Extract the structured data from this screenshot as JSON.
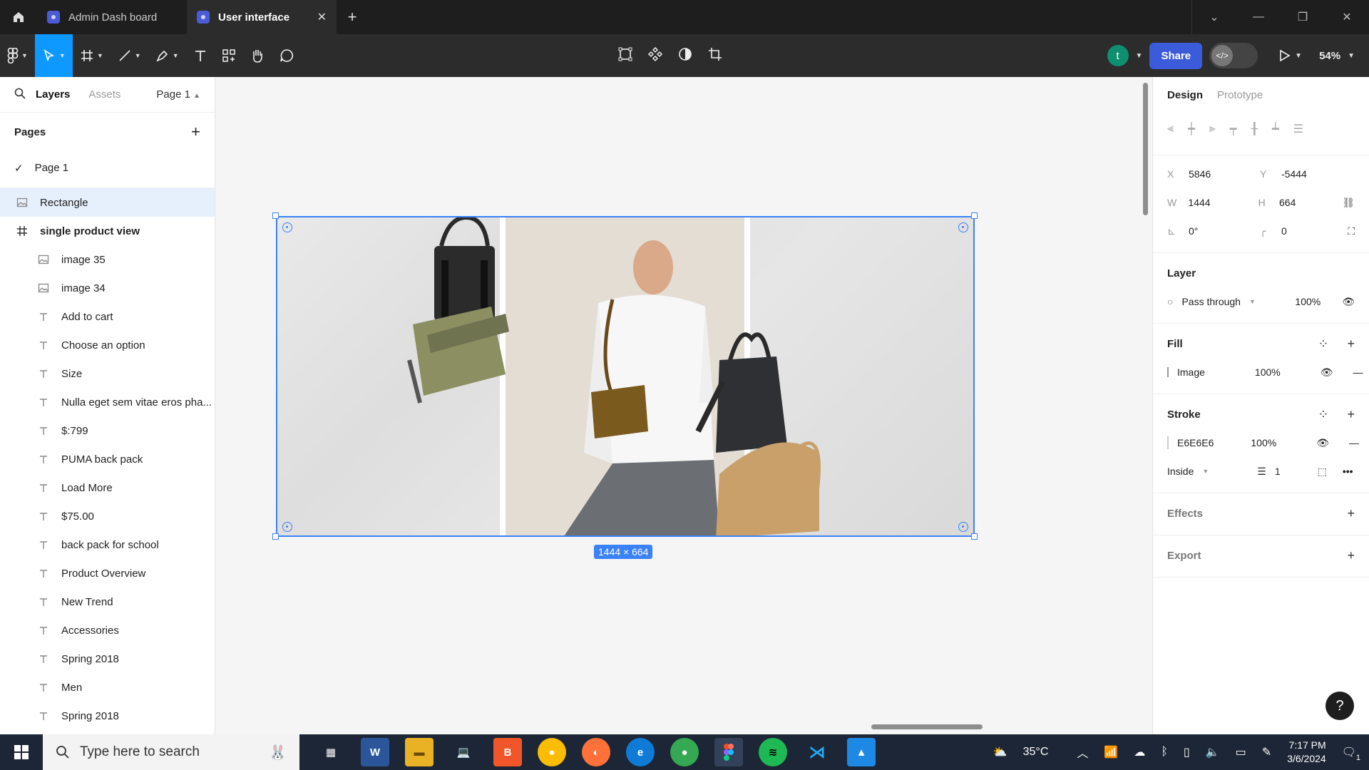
{
  "tabs": [
    {
      "label": "Admin Dash board",
      "active": false
    },
    {
      "label": "User interface",
      "active": true
    }
  ],
  "window_controls": {
    "dropdown": "⌄",
    "minimize": "—",
    "restore": "❐",
    "close": "✕"
  },
  "toolbar": {
    "avatar_initial": "t",
    "share_label": "Share",
    "zoom": "54%"
  },
  "left_panel": {
    "tabs": [
      "Layers",
      "Assets"
    ],
    "page_selector": "Page 1",
    "pages_heading": "Pages",
    "pages": [
      "Page 1"
    ],
    "layers": [
      {
        "label": "Rectangle",
        "type": "image",
        "selected": true
      },
      {
        "label": "single product view",
        "type": "frame"
      },
      {
        "label": "image 35",
        "type": "image"
      },
      {
        "label": "image 34",
        "type": "image"
      },
      {
        "label": "Add to cart",
        "type": "text"
      },
      {
        "label": "Choose an option",
        "type": "text"
      },
      {
        "label": "Size",
        "type": "text"
      },
      {
        "label": "Nulla eget sem vitae eros pha...",
        "type": "text"
      },
      {
        "label": "$:799",
        "type": "text"
      },
      {
        "label": "PUMA back pack",
        "type": "text"
      },
      {
        "label": "Load More",
        "type": "text"
      },
      {
        "label": "$75.00",
        "type": "text"
      },
      {
        "label": "back pack for school",
        "type": "text"
      },
      {
        "label": "Product Overview",
        "type": "text"
      },
      {
        "label": "New Trend",
        "type": "text"
      },
      {
        "label": "Accessories",
        "type": "text"
      },
      {
        "label": "Spring 2018",
        "type": "text"
      },
      {
        "label": "Men",
        "type": "text"
      },
      {
        "label": "Spring 2018",
        "type": "text"
      }
    ]
  },
  "canvas": {
    "dimension_badge": "1444 × 664"
  },
  "right_panel": {
    "tabs": [
      "Design",
      "Prototype"
    ],
    "props": {
      "x_label": "X",
      "x": "5846",
      "y_label": "Y",
      "y": "-5444",
      "w_label": "W",
      "w": "1444",
      "h_label": "H",
      "h": "664",
      "rotation": "0°",
      "radius": "0"
    },
    "layer": {
      "heading": "Layer",
      "blend": "Pass through",
      "opacity": "100%"
    },
    "fill": {
      "heading": "Fill",
      "type": "Image",
      "opacity": "100%"
    },
    "stroke": {
      "heading": "Stroke",
      "color": "E6E6E6",
      "opacity": "100%",
      "position": "Inside",
      "weight": "1"
    },
    "effects_heading": "Effects",
    "export_heading": "Export"
  },
  "taskbar": {
    "search_placeholder": "Type here to search",
    "weather": "35°C",
    "time": "7:17 PM",
    "date": "3/6/2024",
    "notification_count": "1"
  },
  "colors": {
    "accent": "#0d99ff",
    "selection": "#3b82f6",
    "share": "#3b5bdb",
    "avatar": "#0f8f6f"
  }
}
